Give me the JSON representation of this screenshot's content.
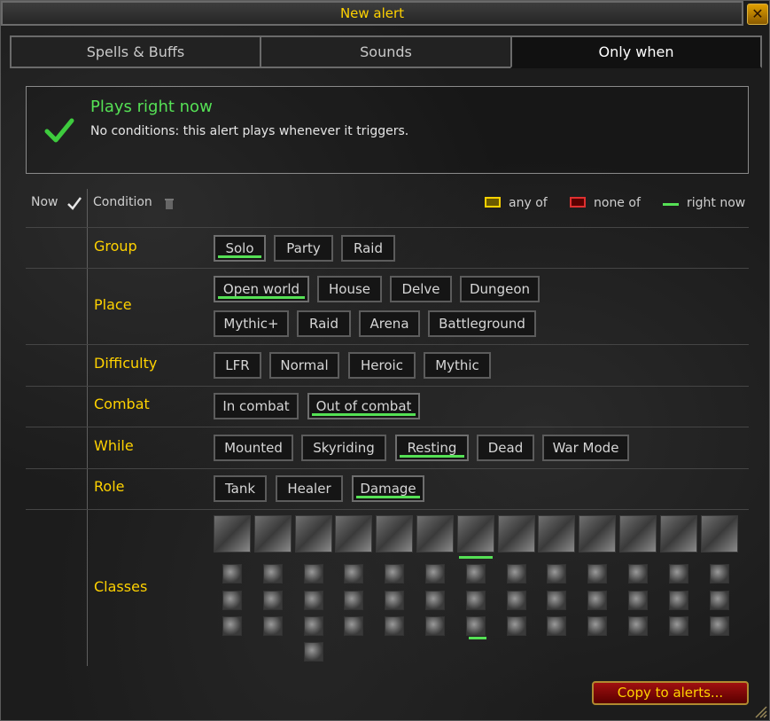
{
  "window": {
    "title": "New alert",
    "close_label": "✕"
  },
  "tabs": [
    {
      "label": "Spells & Buffs",
      "active": false
    },
    {
      "label": "Sounds",
      "active": false
    },
    {
      "label": "Only when",
      "active": true
    }
  ],
  "status": {
    "title": "Plays right now",
    "description": "No conditions: this alert plays whenever it triggers.",
    "icon": "green-check-icon",
    "color": "#55e155"
  },
  "header": {
    "now_label": "Now",
    "condition_label": "Condition",
    "legend": [
      {
        "label": "any of",
        "color": "#ffd200"
      },
      {
        "label": "none of",
        "color": "#e03030"
      },
      {
        "label": "right now",
        "color": "#55e155"
      }
    ]
  },
  "conditions": {
    "group": {
      "label": "Group",
      "options": [
        "Solo",
        "Party",
        "Raid"
      ],
      "right_now": [
        "Solo"
      ]
    },
    "place": {
      "label": "Place",
      "options": [
        "Open world",
        "House",
        "Delve",
        "Dungeon",
        "Mythic+",
        "Raid",
        "Arena",
        "Battleground"
      ],
      "right_now": [
        "Open world"
      ]
    },
    "difficulty": {
      "label": "Difficulty",
      "options": [
        "LFR",
        "Normal",
        "Heroic",
        "Mythic"
      ],
      "right_now": []
    },
    "combat": {
      "label": "Combat",
      "options": [
        "In combat",
        "Out of combat"
      ],
      "right_now": [
        "Out of combat"
      ]
    },
    "while": {
      "label": "While",
      "options": [
        "Mounted",
        "Skyriding",
        "Resting",
        "Dead",
        "War Mode"
      ],
      "right_now": [
        "Resting"
      ]
    },
    "role": {
      "label": "Role",
      "options": [
        "Tank",
        "Healer",
        "Damage"
      ],
      "right_now": [
        "Damage"
      ]
    },
    "classes": {
      "label": "Classes",
      "class_icon_count": 13,
      "spec_icon_count": 40,
      "right_now_class_index": 6
    }
  },
  "footer": {
    "copy_button": "Copy to alerts..."
  },
  "colors": {
    "accent_gold": "#ffd200",
    "right_now_green": "#55e155",
    "none_red": "#e03030"
  }
}
